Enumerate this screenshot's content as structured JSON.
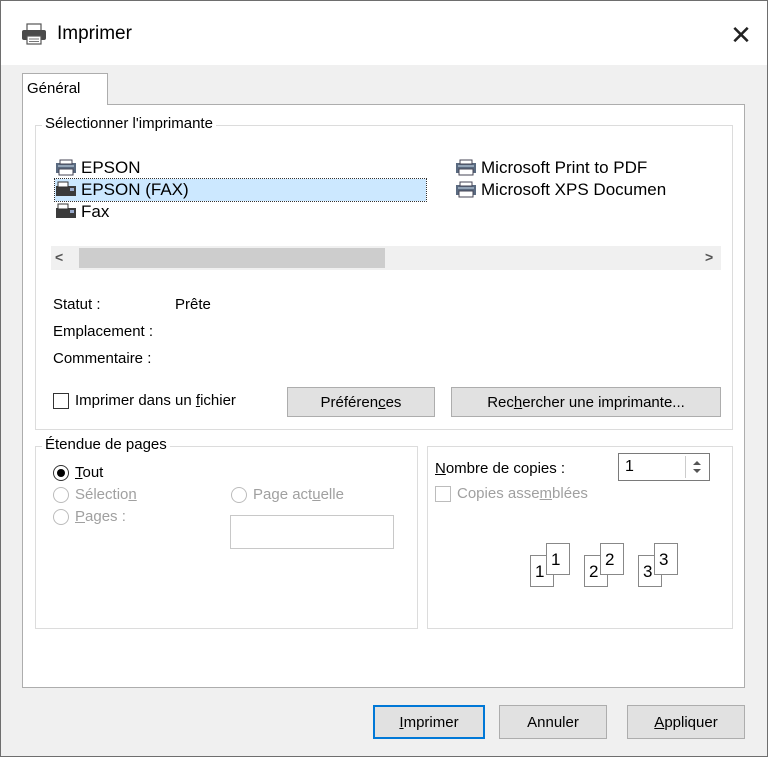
{
  "window": {
    "title": "Imprimer",
    "close_icon": "close-icon"
  },
  "tabs": [
    {
      "label": "Général",
      "selected": true
    }
  ],
  "select_printer": {
    "legend": "Sélectionner l'imprimante",
    "printers": [
      {
        "name": "EPSON",
        "icon": "printer-icon",
        "selected": false
      },
      {
        "name": "EPSON (FAX)",
        "icon": "fax-icon",
        "selected": true
      },
      {
        "name": "Fax",
        "icon": "fax-icon",
        "selected": false
      },
      {
        "name": "Microsoft Print to PDF",
        "icon": "printer-icon",
        "selected": false
      },
      {
        "name": "Microsoft XPS Documen",
        "icon": "printer-icon",
        "selected": false
      }
    ],
    "scroll_left": "<",
    "scroll_right": ">",
    "status_label": "Statut :",
    "status_value": "Prête",
    "location_label": "Emplacement :",
    "location_value": "",
    "comment_label": "Commentaire :",
    "comment_value": "",
    "print_to_file": {
      "label_pre": "Imprimer dans un ",
      "label_u": "f",
      "label_post": "ichier",
      "checked": false
    },
    "preferences": {
      "pre": "Préféren",
      "u": "c",
      "post": "es"
    },
    "find_printer": {
      "pre": "Rec",
      "u": "h",
      "post": "ercher une imprimante..."
    }
  },
  "page_range": {
    "legend": "Étendue de pages",
    "all": {
      "u": "T",
      "post": "out",
      "checked": true
    },
    "selection": {
      "pre": "Sélectio",
      "u": "n",
      "post": "",
      "checked": false,
      "enabled": false
    },
    "current_page": {
      "pre": "Page act",
      "u": "u",
      "post": "elle",
      "checked": false,
      "enabled": false
    },
    "pages": {
      "u": "P",
      "post": "ages :",
      "checked": false,
      "enabled": false,
      "value": ""
    }
  },
  "copies": {
    "count_label_u": "N",
    "count_label_post": "ombre de copies :",
    "count_value": "1",
    "collate": {
      "pre": "Copies asse",
      "u": "m",
      "post": "blées",
      "checked": false,
      "enabled": false
    },
    "collate_pages": [
      "1",
      "1",
      "2",
      "2",
      "3",
      "3"
    ]
  },
  "footer": {
    "print": {
      "u": "I",
      "post": "mprimer"
    },
    "cancel": "Annuler",
    "apply": {
      "u": "A",
      "post": "ppliquer"
    }
  }
}
